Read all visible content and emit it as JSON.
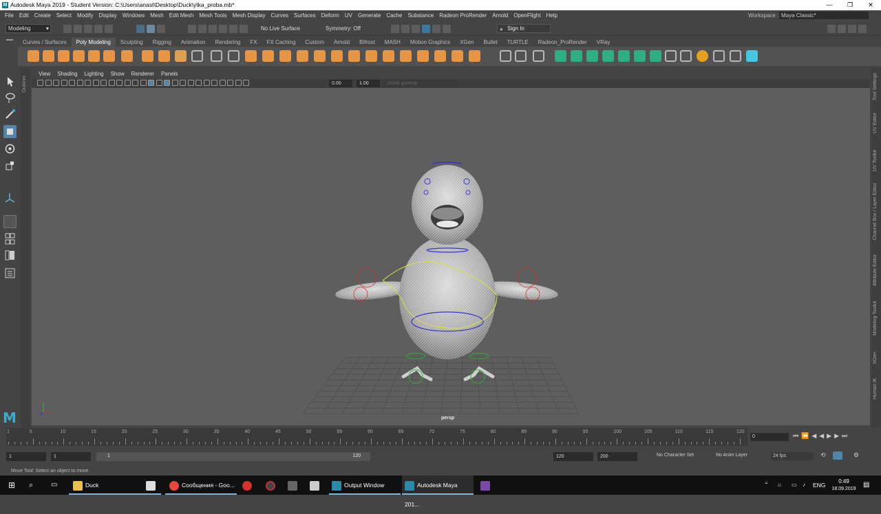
{
  "window": {
    "title": "Autodesk Maya 2019 - Student Version: C:\\Users\\anast\\Desktop\\Duck\\ytka_proba.mb*",
    "minimize": "—",
    "maximize": "❐",
    "close": "✕"
  },
  "menubar": {
    "items": [
      "File",
      "Edit",
      "Create",
      "Select",
      "Modify",
      "Display",
      "Windows",
      "Mesh",
      "Edit Mesh",
      "Mesh Tools",
      "Mesh Display",
      "Curves",
      "Surfaces",
      "Deform",
      "UV",
      "Generate",
      "Cache",
      "Substance",
      "Radeon ProRender",
      "Arnold",
      "OpenFlight",
      "Help"
    ],
    "workspace_label": "Workspace :",
    "workspace_value": "Maya Classic*"
  },
  "statusline": {
    "mode": "Modeling",
    "live_surface": "No Live Surface",
    "symmetry": "Symmetry: Off",
    "sign_in": "Sign In"
  },
  "shelf": {
    "tabs": [
      "Curves / Surfaces",
      "Poly Modeling",
      "Sculpting",
      "Rigging",
      "Animation",
      "Rendering",
      "FX",
      "FX Caching",
      "Custom",
      "Arnold",
      "Bifrost",
      "MASH",
      "Motion Graphics",
      "XGen",
      "Bullet",
      "TURTLE",
      "Radeon_ProRender",
      "VRay"
    ],
    "active_tab": "Poly Modeling"
  },
  "panel": {
    "menus": [
      "View",
      "Shading",
      "Lighting",
      "Show",
      "Renderer",
      "Panels"
    ],
    "exposure": "0.00",
    "gamma": "1.00",
    "color_space": "sRGB gamma",
    "camera_label": "persp"
  },
  "left_strip_label": "Outliner",
  "right_tabs": [
    "Tool Settings",
    "UV Editor",
    "UV Toolkit",
    "Channel Box / Layer Editor",
    "Attribute Editor",
    "Modeling Toolkit",
    "XGen",
    "Human IK"
  ],
  "timeline": {
    "ticks": [
      "5",
      "10",
      "15",
      "20",
      "25",
      "30",
      "35",
      "40",
      "45",
      "50",
      "55",
      "60",
      "65",
      "70",
      "75",
      "80",
      "85",
      "90",
      "95",
      "100",
      "105",
      "110",
      "115",
      "120"
    ],
    "current_frame": "0",
    "first_tick": "1"
  },
  "range": {
    "start": "1",
    "start2": "1",
    "slider_start": "1",
    "slider_end": "120",
    "end": "120",
    "end2": "200",
    "character_set": "No Character Set",
    "anim_layer": "No Anim Layer",
    "fps": "24 fps"
  },
  "help_line": "Move Tool: Select an object to move.",
  "taskbar": {
    "items": [
      {
        "label": "Duck"
      },
      {
        "label": "Сообщения - Goo..."
      },
      {
        "label": "Output Window"
      },
      {
        "label": "Autodesk Maya 201..."
      }
    ],
    "lang": "ENG",
    "time": "0:49",
    "date": "18.09.2019"
  },
  "colors": {
    "accent": "#5285a6",
    "shelf_orange": "#e69545",
    "shelf_green": "#2fae86",
    "shelf_cyan": "#44c8e0"
  }
}
